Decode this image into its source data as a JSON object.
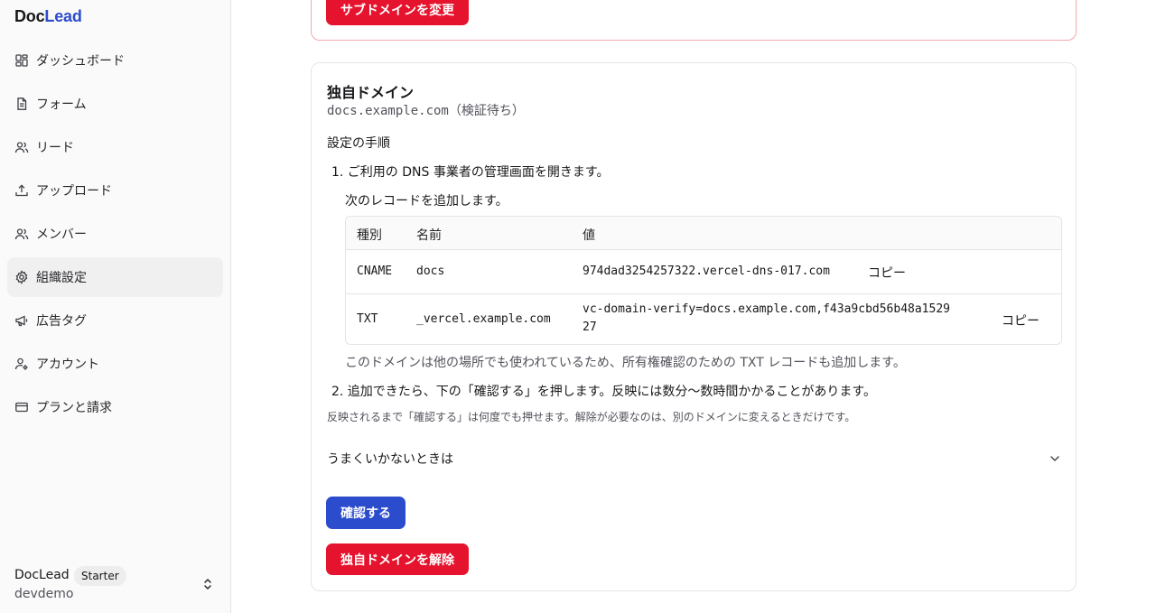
{
  "brand": {
    "part1": "Doc",
    "part2": "Lead"
  },
  "sidebar": {
    "items": [
      {
        "label": "ダッシュボード",
        "icon": "dashboard-icon"
      },
      {
        "label": "フォーム",
        "icon": "file-icon"
      },
      {
        "label": "リード",
        "icon": "users-icon"
      },
      {
        "label": "アップロード",
        "icon": "upload-icon"
      },
      {
        "label": "メンバー",
        "icon": "users-icon"
      },
      {
        "label": "組織設定",
        "icon": "gear-icon"
      },
      {
        "label": "広告タグ",
        "icon": "megaphone-icon"
      },
      {
        "label": "アカウント",
        "icon": "user-gear-icon"
      },
      {
        "label": "プランと請求",
        "icon": "credit-card-icon"
      }
    ],
    "active_index": 5,
    "org": {
      "name": "DocLead",
      "plan": "Starter",
      "slug": "devdemo"
    }
  },
  "subdomain": {
    "change_button": "サブドメインを変更"
  },
  "custom_domain": {
    "title": "独自ドメイン",
    "domain": "docs.example.com",
    "status": "（検証待ち）",
    "steps_title": "設定の手順",
    "step1": "1. ご利用の DNS 事業者の管理画面を開きます。",
    "step1_sub": "次のレコードを追加します。",
    "table": {
      "headers": [
        "種別",
        "名前",
        "値"
      ],
      "rows": [
        {
          "type": "CNAME",
          "name": "docs",
          "value": "974dad3254257322.vercel-dns-017.com",
          "copy": "コピー"
        },
        {
          "type": "TXT",
          "name": "_vercel.example.com",
          "value_line1": "vc-domain-verify=docs.example.com,f43a9cbd56b48a1529",
          "value_line2": "27",
          "copy": "コピー"
        }
      ]
    },
    "txt_note": "このドメインは他の場所でも使われているため、所有権確認のための TXT レコードも追加します。",
    "step2": "2. 追加できたら、下の「確認する」を押します。反映には数分〜数時間かかることがあります。",
    "note": "反映されるまで「確認する」は何度でも押せます。解除が必要なのは、別のドメインに変えるときだけです。",
    "troubleshoot": "うまくいかないときは",
    "verify_button": "確認する",
    "remove_button": "独自ドメインを解除"
  }
}
